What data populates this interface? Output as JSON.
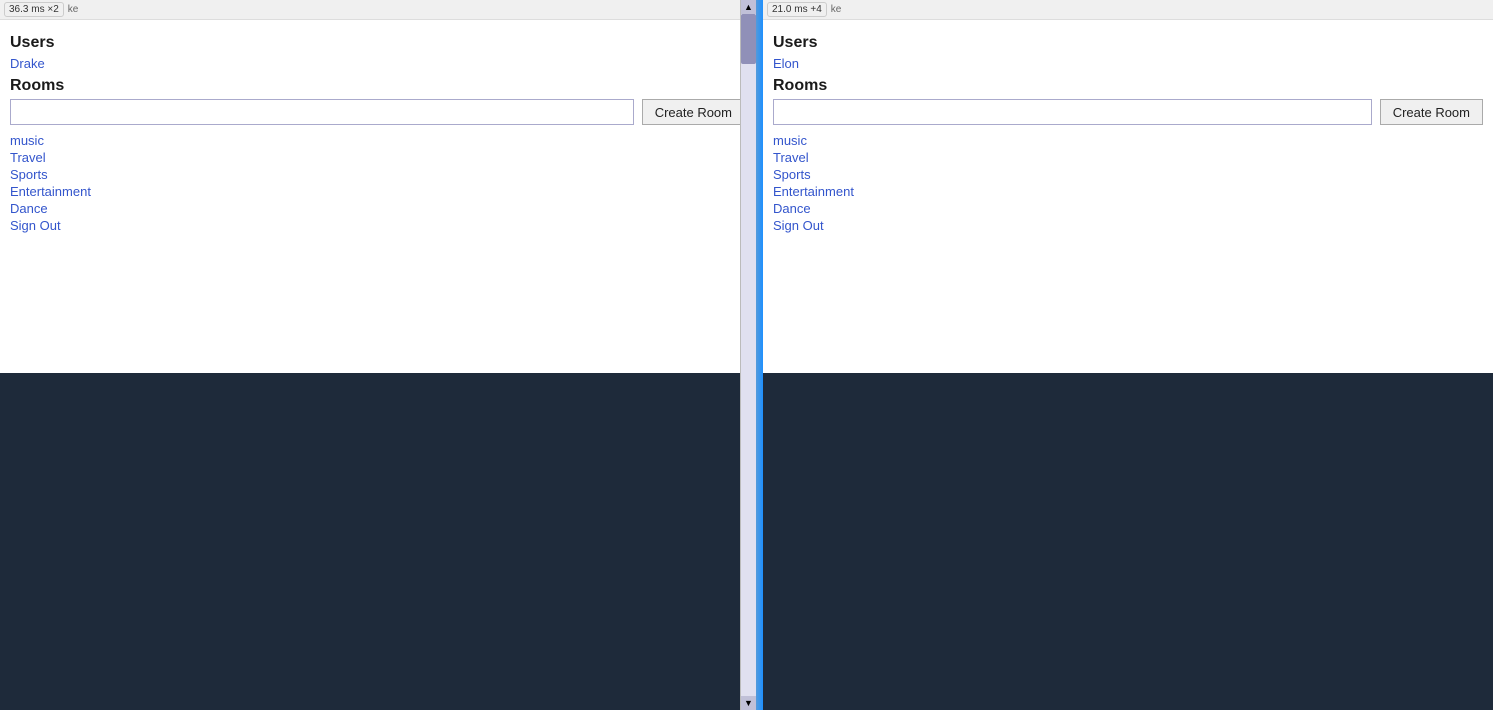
{
  "left_panel": {
    "timing": "36.3 ms",
    "timing_count": "×2",
    "username": "ke",
    "users_label": "Users",
    "user": "Drake",
    "rooms_label": "Rooms",
    "create_room_placeholder": "",
    "create_room_btn": "Create Room",
    "rooms": [
      "music",
      "Travel",
      "Sports",
      "Entertainment",
      "Dance"
    ],
    "sign_out": "Sign Out"
  },
  "right_panel": {
    "timing": "21.0 ms",
    "timing_count": "+4",
    "username": "ke",
    "users_label": "Users",
    "user": "Elon",
    "rooms_label": "Rooms",
    "create_room_placeholder": "",
    "create_room_btn": "Create Room",
    "rooms": [
      "music",
      "Travel",
      "Sports",
      "Entertainment",
      "Dance"
    ],
    "sign_out": "Sign Out"
  },
  "colors": {
    "link": "#3355cc",
    "dark_bg": "#1e2a3a",
    "divider": "#2b7de9"
  }
}
